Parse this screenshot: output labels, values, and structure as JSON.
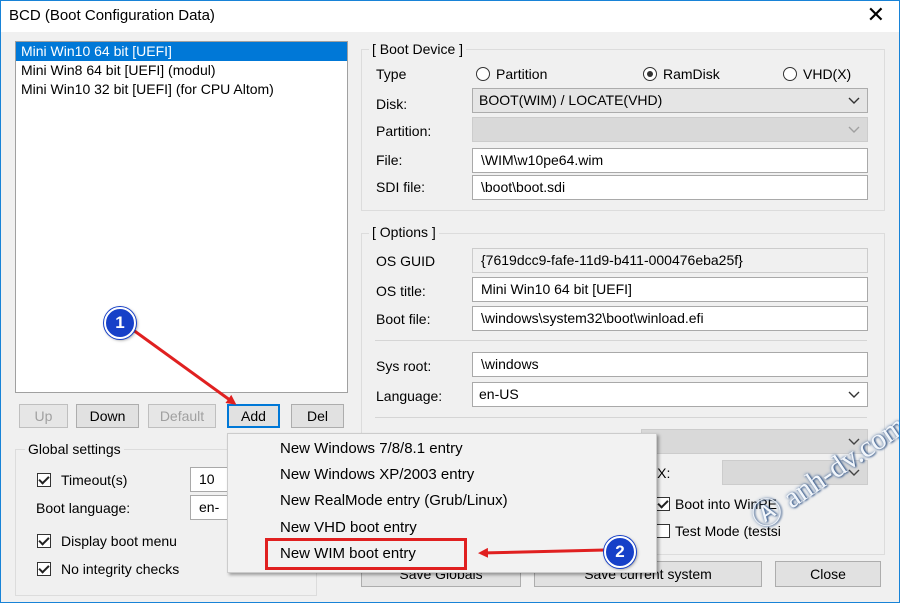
{
  "window": {
    "title": "BCD (Boot Configuration Data)"
  },
  "entries": [
    "Mini Win10 64 bit [UEFI]",
    "Mini Win8 64 bit  [UEFI] (modul)",
    "Mini Win10 32 bit [UEFI] (for CPU Altom)"
  ],
  "list_buttons": {
    "up": "Up",
    "down": "Down",
    "default": "Default",
    "add": "Add",
    "del": "Del"
  },
  "global": {
    "title": "Global settings",
    "timeout_label": "Timeout(s)",
    "timeout_value": "10",
    "boot_language_label": "Boot language:",
    "boot_language_value": "en-",
    "display_boot_menu": "Display boot menu",
    "no_integrity_checks": "No integrity checks"
  },
  "boot_device": {
    "title": "[ Boot Device ]",
    "type_label": "Type",
    "radio_partition": "Partition",
    "radio_ramdisk": "RamDisk",
    "radio_vhd": "VHD(X)",
    "disk_label": "Disk:",
    "disk_value": "BOOT(WIM) / LOCATE(VHD)",
    "partition_label": "Partition:",
    "file_label": "File:",
    "file_value": "\\WIM\\w10pe64.wim",
    "sdi_label": "SDI file:",
    "sdi_value": "\\boot\\boot.sdi"
  },
  "options": {
    "title": "[ Options ]",
    "os_guid_label": "OS GUID",
    "os_guid_value": "{7619dcc9-fafe-11d9-b411-000476eba25f}",
    "os_title_label": "OS title:",
    "os_title_value": "Mini Win10 64 bit [UEFI]",
    "boot_file_label": "Boot file:",
    "boot_file_value": "\\windows\\system32\\boot\\winload.efi",
    "sys_root_label": "Sys root:",
    "sys_root_value": "\\windows",
    "language_label": "Language:",
    "language_value": "en-US",
    "nx_label": "NX:",
    "boot_into_winpe": "Boot into WinPE",
    "test_mode": "Test Mode (testsi"
  },
  "bottom_buttons": {
    "save_globals": "Save Globals",
    "save_current": "Save current system",
    "close": "Close"
  },
  "menu": {
    "items": [
      "New Windows 7/8/8.1 entry",
      "New Windows XP/2003 entry",
      "New RealMode entry (Grub/Linux)",
      "New VHD boot entry",
      "New WIM boot entry"
    ]
  },
  "annotations": {
    "badge_1": "1",
    "badge_2": "2",
    "arrow_color": "#e02020",
    "badge_color": "#1640c8"
  },
  "watermark": {
    "text": "anh-dv.com"
  }
}
